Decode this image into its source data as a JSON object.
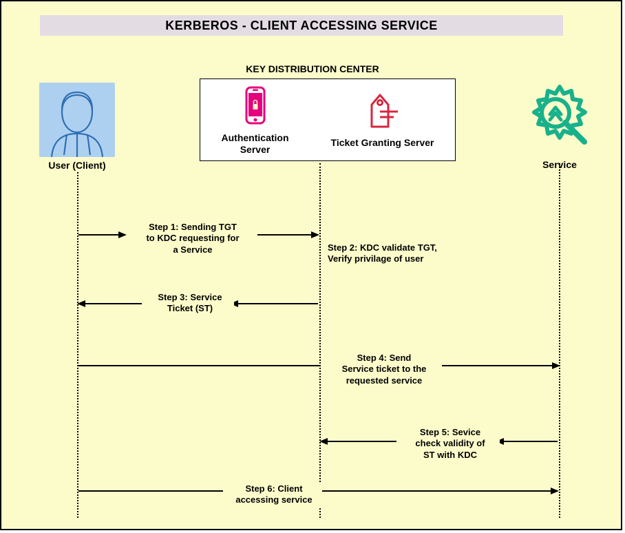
{
  "title": "KERBEROS - CLIENT ACCESSING SERVICE",
  "kdc": {
    "title": "KEY DISTRIBUTION CENTER",
    "auth_label": "Authentication\nServer",
    "tgs_label": "Ticket Granting Server"
  },
  "user_label": "User (Client)",
  "service_label": "Service",
  "steps": {
    "s1": "Step 1: Sending TGT\nto KDC requesting for\na Service",
    "s2": "Step 2: KDC validate TGT,\nVerify privilage of user",
    "s3": "Step 3: Service\nTicket (ST)",
    "s4": "Step 4: Send\nService ticket to the\nrequested service",
    "s5": "Step 5: Sevice\ncheck validity of\nST with KDC",
    "s6": "Step 6: Client\naccessing service"
  }
}
